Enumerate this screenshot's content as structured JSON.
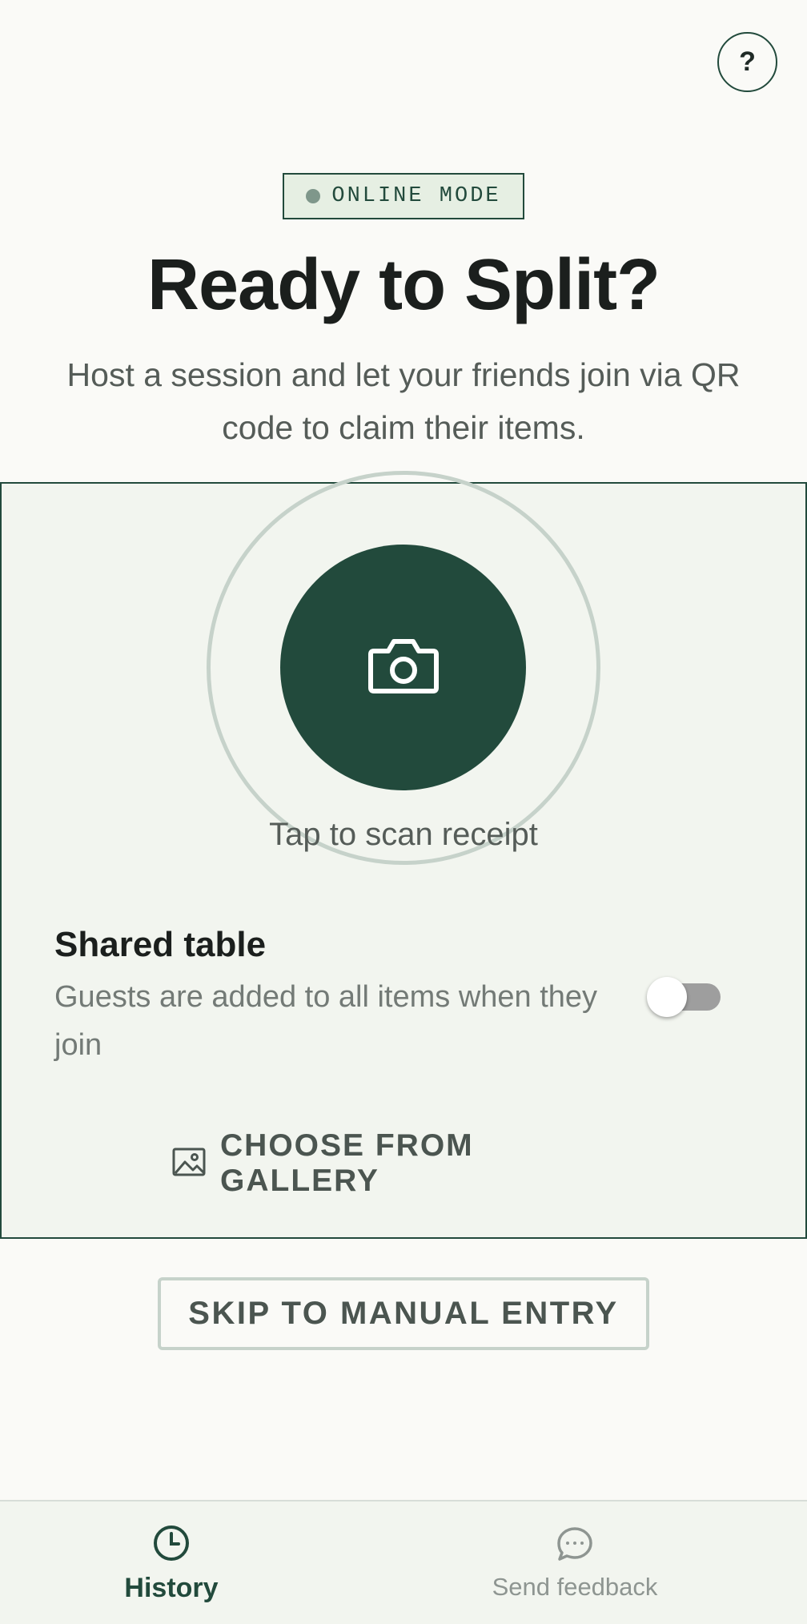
{
  "header": {
    "help_label": "?"
  },
  "mode_badge": {
    "label": "ONLINE MODE"
  },
  "hero": {
    "title": "Ready to Split?",
    "subtitle": "Host a session and let your friends join via QR code to claim their items."
  },
  "scan": {
    "label": "Tap to scan receipt",
    "icon": "camera-icon"
  },
  "shared_table": {
    "title": "Shared table",
    "description": "Guests are added to all items when they join",
    "enabled": false
  },
  "gallery": {
    "label": "CHOOSE FROM GALLERY",
    "icon": "image-icon"
  },
  "skip": {
    "label": "SKIP TO MANUAL ENTRY"
  },
  "nav": {
    "items": [
      {
        "label": "History",
        "icon": "clock-icon",
        "active": true
      },
      {
        "label": "Send feedback",
        "icon": "chat-bubble-icon",
        "active": false
      }
    ]
  },
  "colors": {
    "primary": "#224a3c",
    "background": "#fafaf7",
    "card_bg": "#f2f5ef",
    "badge_bg": "#e6efe3",
    "ring": "#c6d2ca",
    "muted_text": "#737a76"
  }
}
